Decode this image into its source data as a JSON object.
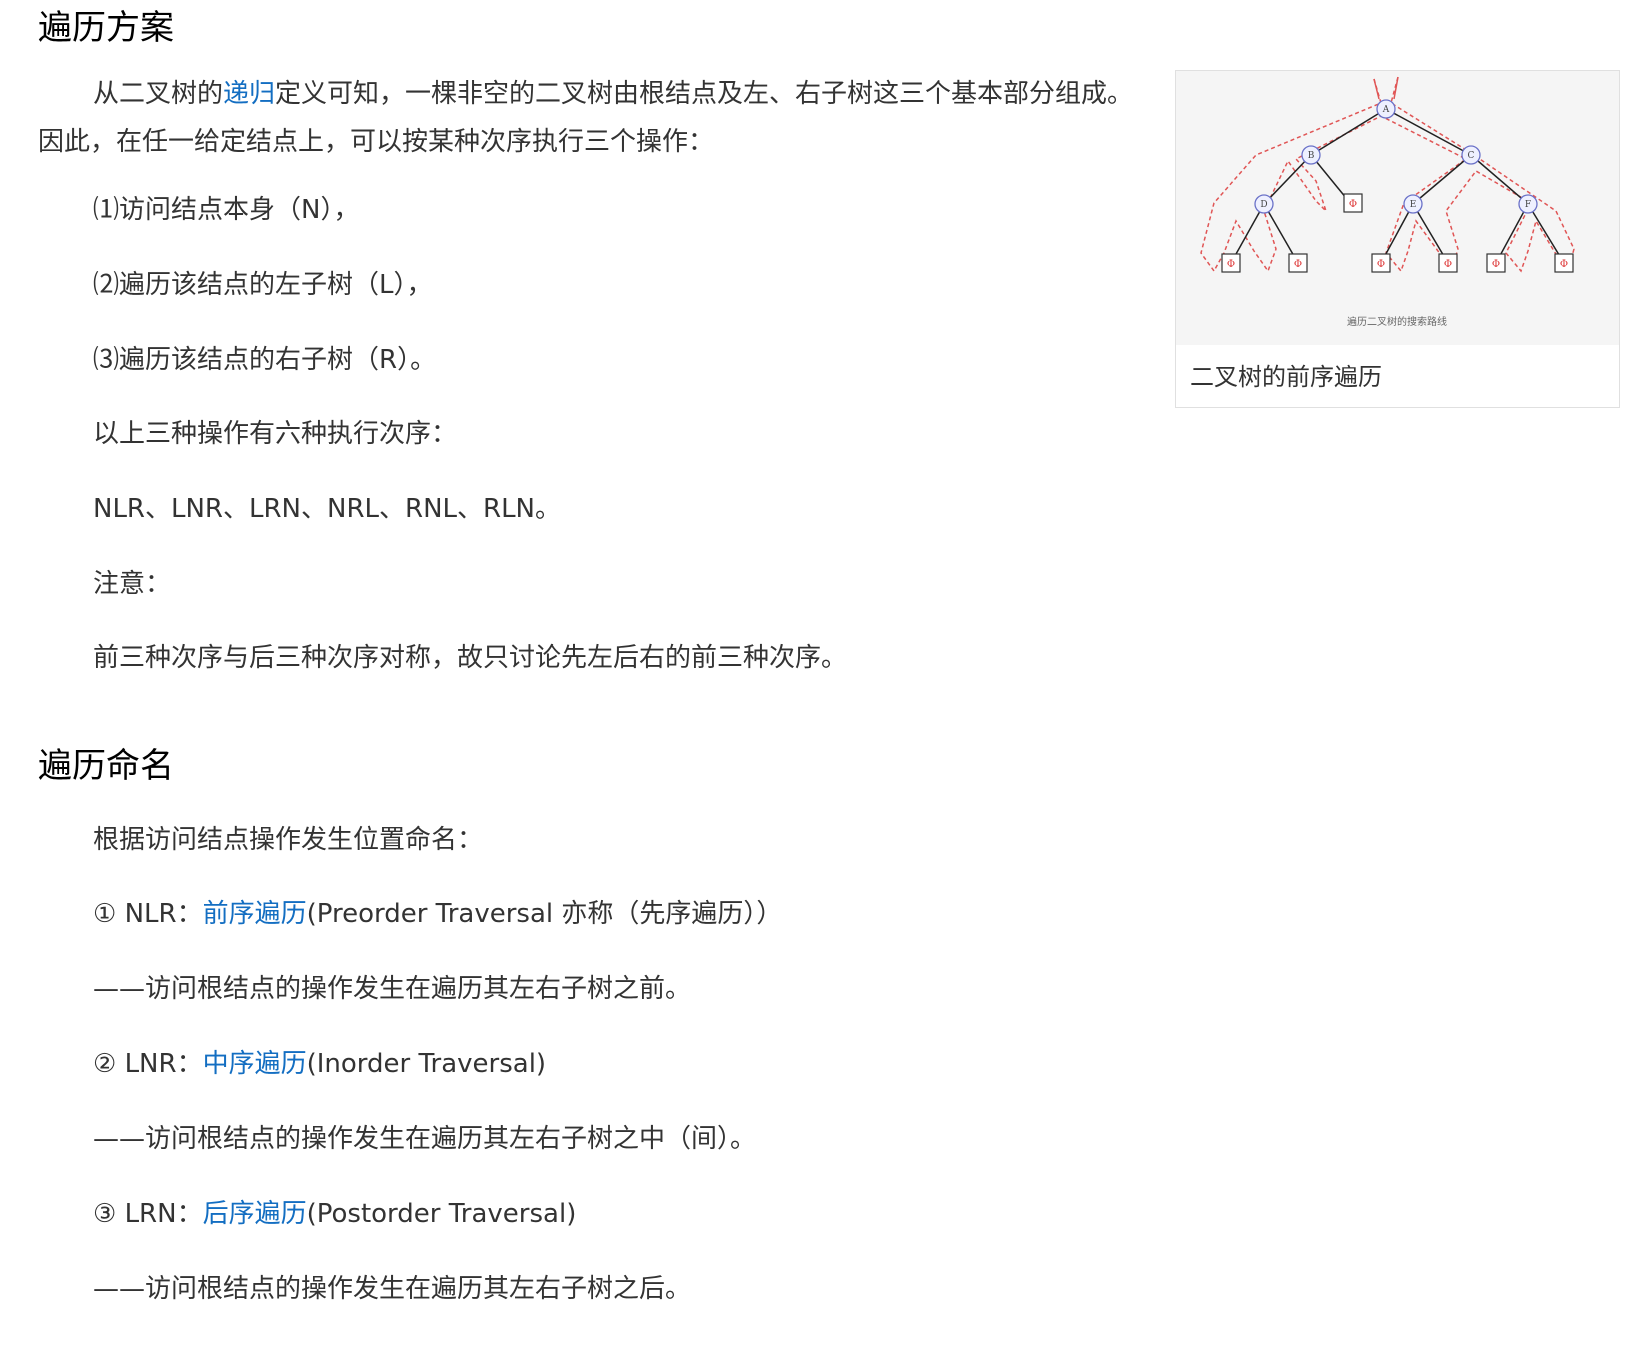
{
  "section1": {
    "title": "遍历方案",
    "para1_before": "从二叉树的",
    "para1_link": "递归",
    "para1_after": "定义可知，一棵非空的二叉树由根结点及左、右子树这三个基本部分组成。因此，在任一给定结点上，可以按某种次序执行三个操作：",
    "item1": "⑴访问结点本身（N），",
    "item2": "⑵遍历该结点的左子树（L），",
    "item3": "⑶遍历该结点的右子树（R）。",
    "line_six": "以上三种操作有六种执行次序：",
    "orders": "NLR、LNR、LRN、NRL、RNL、RLN。",
    "note_label": "注意：",
    "note_text": "前三种次序与后三种次序对称，故只讨论先左后右的前三种次序。"
  },
  "figure": {
    "caption": "二叉树的前序遍历",
    "image_title": "遍历二叉树的搜索路线",
    "nodes": [
      "A",
      "B",
      "C",
      "D",
      "E",
      "F"
    ],
    "leaf_symbol": "Φ"
  },
  "section2": {
    "title": "遍历命名",
    "intro": "根据访问结点操作发生位置命名：",
    "entries": [
      {
        "prefix": "① NLR：",
        "link": "前序遍历",
        "suffix": "(Preorder Traversal 亦称（先序遍历））",
        "desc": "——访问根结点的操作发生在遍历其左右子树之前。"
      },
      {
        "prefix": "② LNR：",
        "link": "中序遍历",
        "suffix": "(Inorder Traversal)",
        "desc": "——访问根结点的操作发生在遍历其左右子树之中（间）。"
      },
      {
        "prefix": "③ LRN：",
        "link": "后序遍历",
        "suffix": "(Postorder Traversal)",
        "desc": "——访问根结点的操作发生在遍历其左右子树之后。"
      }
    ]
  },
  "colors": {
    "link": "#136ec2",
    "text": "#333333",
    "heading": "#000000",
    "path_red": "#e05555"
  }
}
